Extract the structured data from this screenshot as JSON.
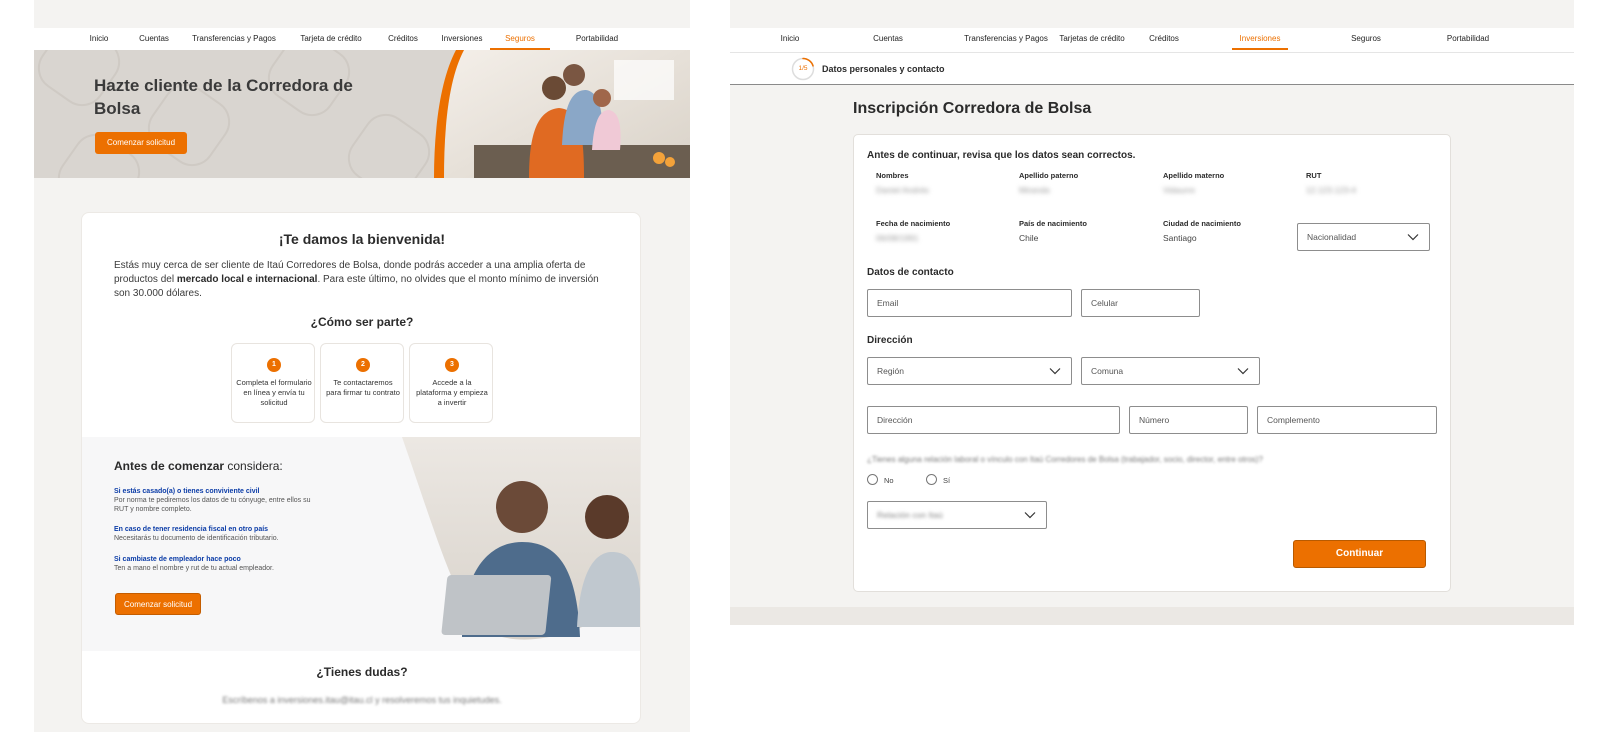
{
  "left": {
    "nav": [
      "Inicio",
      "Cuentas",
      "Transferencias y Pagos",
      "Tarjeta de crédito",
      "Créditos",
      "Inversiones",
      "Seguros",
      "Portabilidad"
    ],
    "nav_active": "Seguros",
    "hero": {
      "title": "Hazte cliente de la Corredora de Bolsa",
      "button": "Comenzar solicitud"
    },
    "welcome": {
      "title": "¡Te damos la bienvenida!",
      "text_1": "Estás muy cerca de ser cliente de Itaú Corredores de Bolsa, donde podrás acceder a una amplia oferta de productos del ",
      "text_bold": "mercado local e internacional",
      "text_2": ". Para este último, no olvides que el monto mínimo de inversión son 30.000 dólares."
    },
    "how": {
      "title": "¿Cómo ser parte?",
      "steps": [
        {
          "num": "1",
          "text": "Completa el formulario en línea y envía tu solicitud"
        },
        {
          "num": "2",
          "text": "Te contactaremos para firmar tu contrato"
        },
        {
          "num": "3",
          "text": "Accede a la plataforma y empieza a invertir"
        }
      ]
    },
    "consider": {
      "title_bold": "Antes de comenzar",
      "title_rest": " considera:",
      "items": [
        {
          "head": "Si estás casado(a) o tienes conviviente civil",
          "body": "Por norma te pediremos los datos de tu cónyuge, entre ellos su RUT y nombre completo."
        },
        {
          "head": "En caso de tener residencia fiscal en otro país",
          "body": "Necesitarás tu documento de identificación tributario."
        },
        {
          "head": "Si cambiaste de empleador hace poco",
          "body": "Ten a mano el nombre y rut de tu actual empleador."
        }
      ],
      "button": "Comenzar solicitud"
    },
    "doubts": {
      "title": "¿Tienes dudas?",
      "text": "Escríbenos a inversiones.itau@itau.cl y resolveremos tus inquietudes."
    }
  },
  "right": {
    "nav": [
      "Inicio",
      "Cuentas",
      "Transferencias y Pagos",
      "Tarjetas de crédito",
      "Créditos",
      "Inversiones",
      "Seguros",
      "Portabilidad"
    ],
    "nav_active": "Inversiones",
    "stepper": {
      "counter": "1/5",
      "label": "Datos personales y contacto",
      "progress": 0.2
    },
    "title": "Inscripción Corredora de Bolsa",
    "intro": "Antes de continuar, revisa que los datos sean correctos.",
    "fields": [
      {
        "label": "Nombres",
        "value": "Daniel Andrés",
        "blur": true
      },
      {
        "label": "Apellido paterno",
        "value": "Miranda",
        "blur": true
      },
      {
        "label": "Apellido materno",
        "value": "Vidaurre",
        "blur": true
      },
      {
        "label": "RUT",
        "value": "12.123.123-4",
        "blur": true
      },
      {
        "label": "Fecha de nacimiento",
        "value": "06/08/1991",
        "blur": true
      },
      {
        "label": "País de nacimiento",
        "value": "Chile",
        "blur": false
      },
      {
        "label": "Ciudad de nacimiento",
        "value": "Santiago",
        "blur": false
      }
    ],
    "nationality_placeholder": "Nacionalidad",
    "contact": {
      "title": "Datos de contacto",
      "email": "Email",
      "phone": "Celular"
    },
    "address": {
      "title": "Dirección",
      "region": "Región",
      "comuna": "Comuna",
      "street": "Dirección",
      "number": "Número",
      "complement": "Complemento"
    },
    "question": "¿Tienes alguna relación laboral o vínculo con Itaú Corredores de Bolsa (trabajador, socio, director, entre otros)?",
    "options": [
      "No",
      "Sí"
    ],
    "relation_placeholder": "Relación con Itaú",
    "continue": "Continuar"
  }
}
